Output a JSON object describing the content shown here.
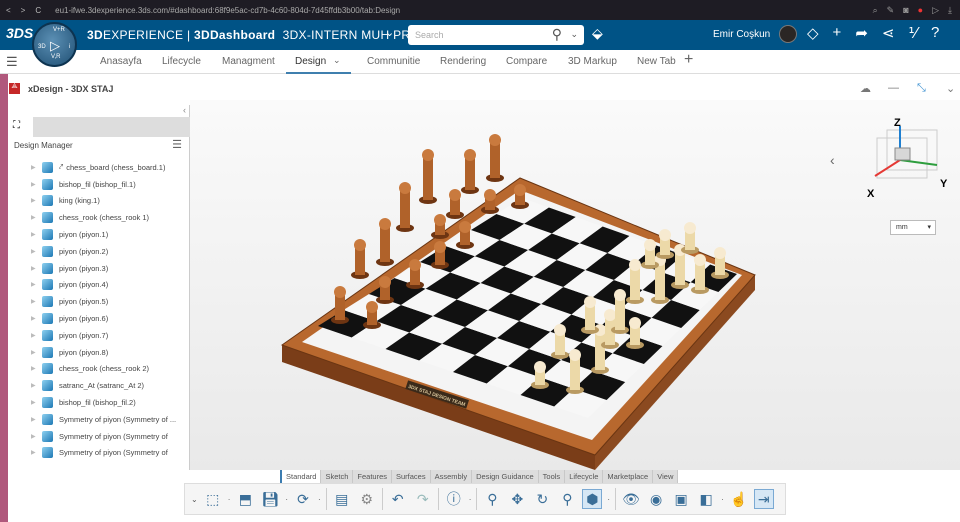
{
  "browser": {
    "url": "eu1-ifwe.3dexperience.3ds.com/#dashboard:68f9e5ac-cd7b-4c60-804d-7d45ffdb3b00/tab:Design"
  },
  "header": {
    "brand_bold": "3D",
    "brand_rest": "EXPERIENCE | ",
    "dashboard": "3DDashboard",
    "workspace": "3DX-INTERN MUH PROGRA",
    "search_placeholder": "Search",
    "user": "Emir Coşkun",
    "compass": {
      "top": "V+R",
      "left": "3D",
      "right": "i",
      "bottom": "V,R"
    }
  },
  "tabs": [
    {
      "label": "Anasayfa"
    },
    {
      "label": "Lifecycle"
    },
    {
      "label": "Managment"
    },
    {
      "label": "Design",
      "active": true
    },
    {
      "label": "Communitie"
    },
    {
      "label": "Rendering"
    },
    {
      "label": "Compare"
    },
    {
      "label": "3D Markup"
    },
    {
      "label": "New Tab"
    }
  ],
  "panel": {
    "title": "xDesign - 3DX STAJ"
  },
  "design_manager": {
    "title": "Design Manager",
    "items": [
      "chess_board (chess_board.1)",
      "bishop_fil (bishop_fil.1)",
      "king (king.1)",
      "chess_rook (chess_rook 1)",
      "piyon (piyon.1)",
      "piyon (piyon.2)",
      "piyon (piyon.3)",
      "piyon (piyon.4)",
      "piyon (piyon.5)",
      "piyon (piyon.6)",
      "piyon (piyon.7)",
      "piyon (piyon.8)",
      "chess_rook (chess_rook 2)",
      "satranc_At (satranc_At 2)",
      "bishop_fil (bishop_fil.2)",
      "Symmetry of piyon (Symmetry of ...",
      "Symmetry of piyon (Symmetry of",
      "Symmetry of piyon (Symmetry of"
    ]
  },
  "viewport": {
    "units": "mm",
    "axes": {
      "x": "X",
      "y": "Y",
      "z": "Z"
    },
    "plate_text": "3DX STAJ DESIGN TEAM",
    "colors": {
      "x": "#e53935",
      "y": "#2e9e3e",
      "z": "#1e7fd0"
    }
  },
  "toolbar": {
    "tabs": [
      "Standard",
      "Sketch",
      "Features",
      "Surfaces",
      "Assembly",
      "Design Guidance",
      "Tools",
      "Lifecycle",
      "Marketplace",
      "View"
    ],
    "active_tab": "Standard"
  }
}
